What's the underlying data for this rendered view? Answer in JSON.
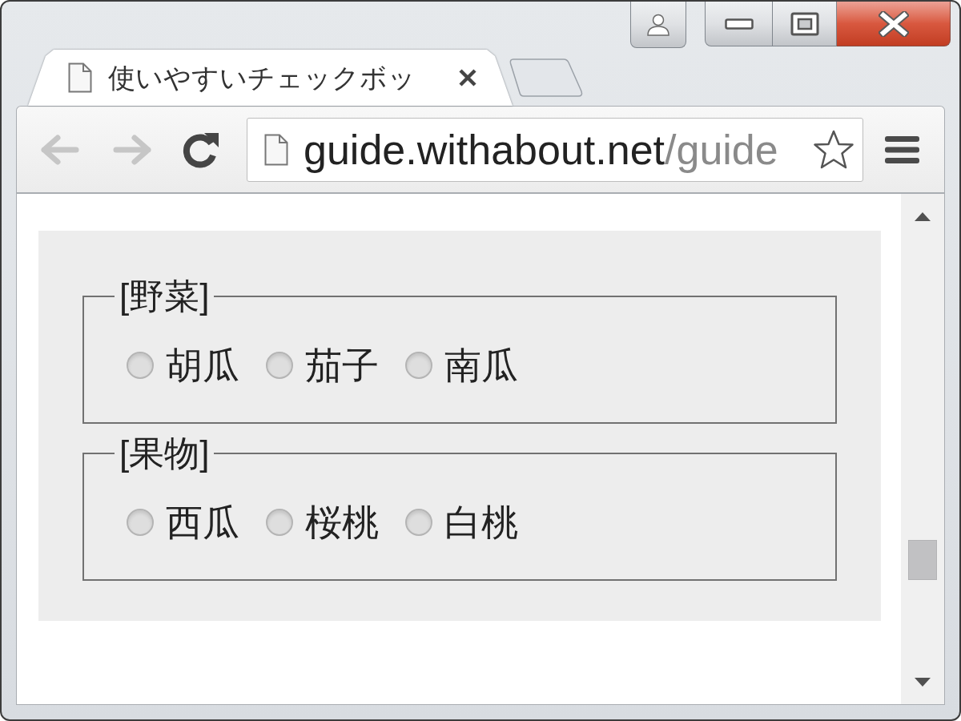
{
  "tabs": [
    {
      "title": "使いやすいチェックボッ",
      "selected": true
    }
  ],
  "toolbar": {
    "back": {
      "disabled": true
    },
    "forward": {
      "disabled": true
    },
    "address": {
      "host": "guide.withabout.net",
      "path": "/guide"
    }
  },
  "fieldsets": [
    {
      "legend": "[野菜]",
      "options": [
        {
          "label": "胡瓜",
          "selected": false
        },
        {
          "label": "茄子",
          "selected": false
        },
        {
          "label": "南瓜",
          "selected": false
        }
      ]
    },
    {
      "legend": "[果物]",
      "options": [
        {
          "label": "西瓜",
          "selected": false
        },
        {
          "label": "桜桃",
          "selected": false
        },
        {
          "label": "白桃",
          "selected": false
        }
      ]
    }
  ]
}
